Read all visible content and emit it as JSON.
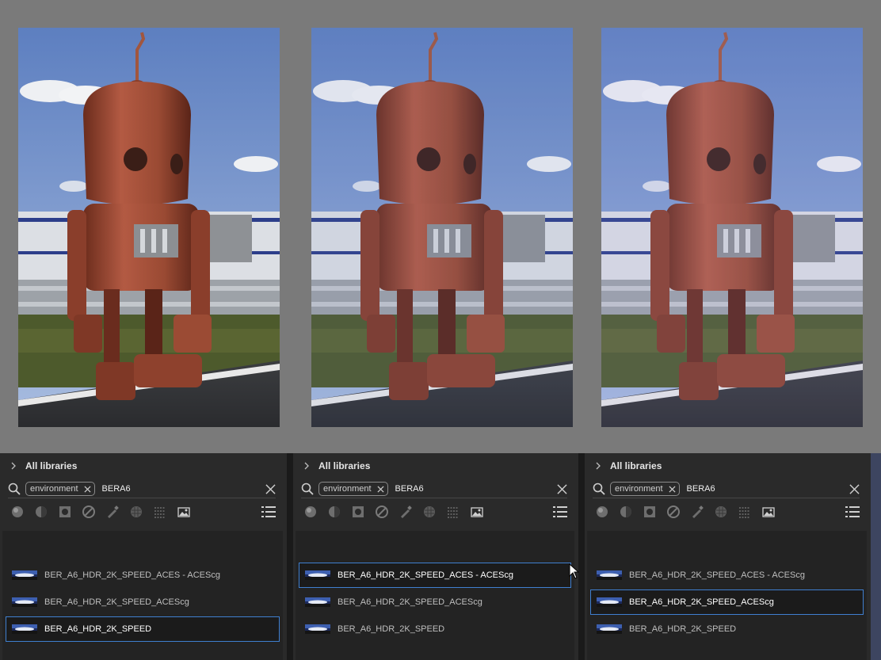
{
  "panels": [
    {
      "breadcrumb": "All libraries",
      "filter_chip": "environment",
      "query": "BERA6",
      "items": [
        {
          "label": "BER_A6_HDR_2K_SPEED_ACES - ACEScg",
          "selected": false
        },
        {
          "label": "BER_A6_HDR_2K_SPEED_ACEScg",
          "selected": false
        },
        {
          "label": "BER_A6_HDR_2K_SPEED",
          "selected": true
        }
      ]
    },
    {
      "breadcrumb": "All libraries",
      "filter_chip": "environment",
      "query": "BERA6",
      "items": [
        {
          "label": "BER_A6_HDR_2K_SPEED_ACES - ACEScg",
          "selected": true
        },
        {
          "label": "BER_A6_HDR_2K_SPEED_ACEScg",
          "selected": false
        },
        {
          "label": "BER_A6_HDR_2K_SPEED",
          "selected": false
        }
      ]
    },
    {
      "breadcrumb": "All libraries",
      "filter_chip": "environment",
      "query": "BERA6",
      "items": [
        {
          "label": "BER_A6_HDR_2K_SPEED_ACES - ACEScg",
          "selected": false
        },
        {
          "label": "BER_A6_HDR_2K_SPEED_ACEScg",
          "selected": true
        },
        {
          "label": "BER_A6_HDR_2K_SPEED",
          "selected": false
        }
      ]
    }
  ],
  "filter_icons": [
    "material-sphere-icon",
    "smart-material-icon",
    "mask-icon",
    "filter-icon",
    "brush-icon",
    "alpha-icon",
    "texture-grid-icon",
    "environment-icon"
  ],
  "colors": {
    "selection_border": "#3f7fd0",
    "panel_bg": "#2a2a2a",
    "list_bg": "#232323"
  }
}
